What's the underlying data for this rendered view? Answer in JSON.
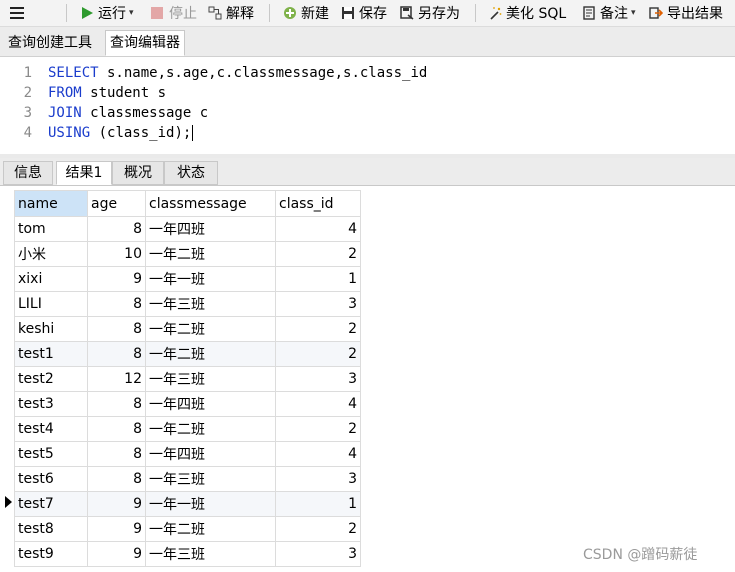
{
  "toolbar": {
    "run_label": "运行",
    "stop_label": "停止",
    "explain_label": "解释",
    "new_label": "新建",
    "save_label": "保存",
    "save_as_label": "另存为",
    "beautify_label": "美化 SQL",
    "note_label": "备注",
    "export_label": "导出结果"
  },
  "query_tabs": [
    "查询创建工具",
    "查询编辑器"
  ],
  "editor": {
    "lines": [
      {
        "no": "1",
        "kw": "SELECT",
        "rest": " s.name,s.age,c.classmessage,s.class_id"
      },
      {
        "no": "2",
        "kw": "FROM",
        "rest": " student s"
      },
      {
        "no": "3",
        "kw": "JOIN",
        "rest": " classmessage c"
      },
      {
        "no": "4",
        "kw": "USING",
        "rest": " (class_id);"
      }
    ]
  },
  "result_tabs": [
    "信息",
    "结果1",
    "概况",
    "状态"
  ],
  "grid": {
    "columns": [
      "name",
      "age",
      "classmessage",
      "class_id"
    ],
    "rows": [
      [
        "tom",
        "8",
        "一年四班",
        "4"
      ],
      [
        "小米",
        "10",
        "一年二班",
        "2"
      ],
      [
        "xixi",
        "9",
        "一年一班",
        "1"
      ],
      [
        "LILI",
        "8",
        "一年三班",
        "3"
      ],
      [
        "keshi",
        "8",
        "一年二班",
        "2"
      ],
      [
        "test1",
        "8",
        "一年二班",
        "2"
      ],
      [
        "test2",
        "12",
        "一年三班",
        "3"
      ],
      [
        "test3",
        "8",
        "一年四班",
        "4"
      ],
      [
        "test4",
        "8",
        "一年二班",
        "2"
      ],
      [
        "test5",
        "8",
        "一年四班",
        "4"
      ],
      [
        "test6",
        "8",
        "一年三班",
        "3"
      ],
      [
        "test7",
        "9",
        "一年一班",
        "1"
      ],
      [
        "test8",
        "9",
        "一年二班",
        "2"
      ],
      [
        "test9",
        "9",
        "一年三班",
        "3"
      ]
    ],
    "current_row": 11
  },
  "watermark": "CSDN @蹭码薪徒",
  "colors": {
    "keyword": "#1a3ccc",
    "selected_header": "#cde3f7",
    "run_icon": "#2e9a2e"
  }
}
